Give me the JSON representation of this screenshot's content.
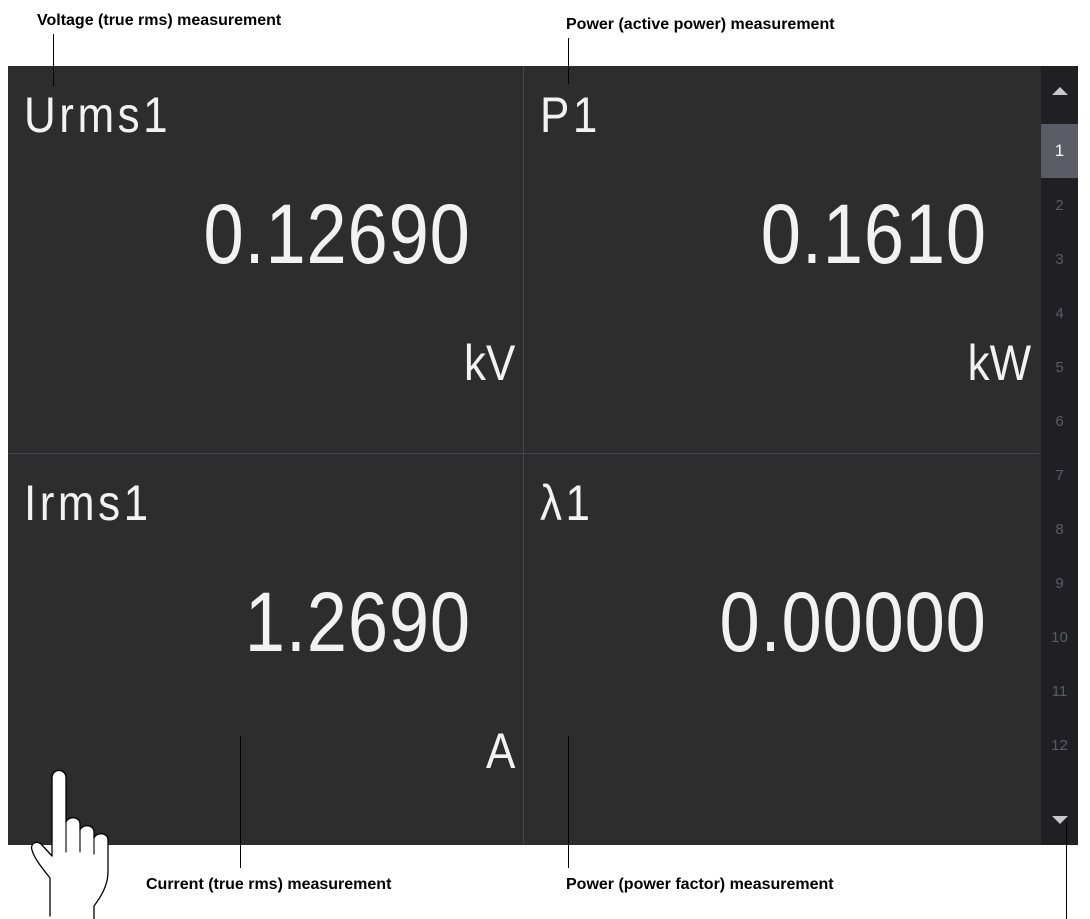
{
  "callouts": {
    "voltage": "Voltage (true rms) measurement",
    "power_active": "Power (active power) measurement",
    "current": "Current (true rms) measurement",
    "power_factor": "Power (power factor) measurement"
  },
  "display": {
    "cells": [
      {
        "item": "Urms1",
        "value": "0.12690",
        "unit": "kV"
      },
      {
        "item": "P1",
        "value": "0.1610",
        "unit": "kW"
      },
      {
        "item": "Irms1",
        "value": "1.2690",
        "unit": "A"
      },
      {
        "item": "λ1",
        "value": "0.00000",
        "unit": ""
      }
    ]
  },
  "scrollbar": {
    "pages": [
      "1",
      "2",
      "3",
      "4",
      "5",
      "6",
      "7",
      "8",
      "9",
      "10",
      "11",
      "12"
    ],
    "active_page": "1",
    "up_icon": "triangle-up-icon",
    "down_icon": "triangle-down-icon"
  },
  "colors": {
    "panel_bg": "#2d2d2d",
    "text": "#f2f2f2",
    "scroll_bg": "#1f1f24",
    "active_page_bg": "#5a5c66"
  }
}
